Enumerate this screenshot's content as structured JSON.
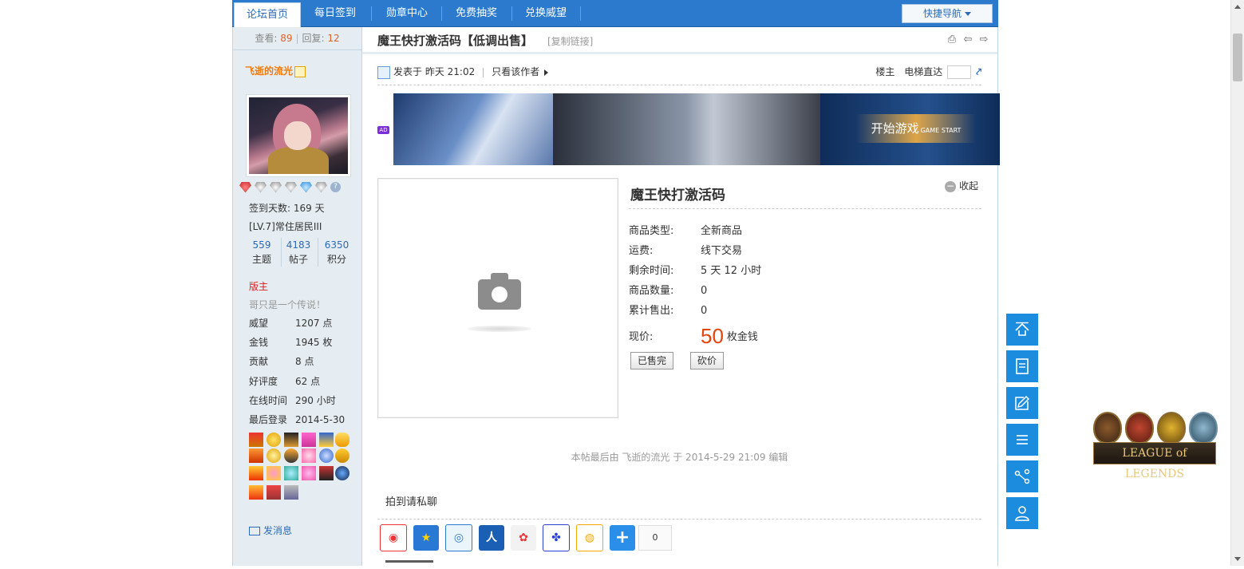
{
  "nav": {
    "tabs": [
      {
        "label": "论坛首页",
        "active": true
      },
      {
        "label": "每日签到",
        "active": false
      },
      {
        "label": "勋章中心",
        "active": false
      },
      {
        "label": "免费抽奖",
        "active": false
      },
      {
        "label": "兑换威望",
        "active": false
      }
    ],
    "quick_nav": "快捷导航"
  },
  "thread_stats": {
    "views_label": "查看:",
    "views": "89",
    "replies_label": "回复:",
    "replies": "12"
  },
  "user": {
    "name": "飞逝的流光",
    "checkin": "签到天数: 169 天",
    "level": "[LV.7]常住居民III",
    "stats": [
      {
        "value": "559",
        "label": "主题"
      },
      {
        "value": "4183",
        "label": "帖子"
      },
      {
        "value": "6350",
        "label": "积分"
      }
    ],
    "role": "版主",
    "motto": "哥只是一个传说！",
    "details": [
      {
        "key": "威望",
        "value": "1207 点"
      },
      {
        "key": "金钱",
        "value": "1945 枚"
      },
      {
        "key": "贡献",
        "value": "8 点"
      },
      {
        "key": "好评度",
        "value": "62 点"
      },
      {
        "key": "在线时间",
        "value": "290 小时"
      },
      {
        "key": "最后登录",
        "value": "2014-5-30"
      }
    ],
    "send_message": "发消息"
  },
  "thread": {
    "title": "魔王快打激活码【低调出售】",
    "copy_link": "[复制链接]",
    "posted": "发表于 昨天 21:02",
    "only_author": "只看该作者",
    "floor_label": "楼主",
    "elevator_label": "电梯直达"
  },
  "banner": {
    "ad_tag": "AD",
    "button": "开始游戏",
    "button_small": "GAME START"
  },
  "product": {
    "name": "魔王快打激活码",
    "collapse": "收起",
    "fields": [
      {
        "key": "商品类型:",
        "value": "全新商品"
      },
      {
        "key": "运费:",
        "value": "线下交易"
      },
      {
        "key": "剩余时间:",
        "value": "5 天 12 小时"
      },
      {
        "key": "商品数量:",
        "value": "0"
      },
      {
        "key": "累计售出:",
        "value": "0"
      }
    ],
    "price_label": "现价:",
    "price": "50",
    "price_unit": "枚金钱",
    "sold_out_button": "已售完",
    "bargain_button": "砍价"
  },
  "post": {
    "edit_note": "本帖最后由 飞逝的流光 于 2014-5-29 21:09 编辑",
    "pm_note": "拍到请私聊",
    "share_count": "0"
  },
  "side_logo": {
    "text": "LEAGUE of LEGENDS"
  },
  "colors": {
    "nav_blue": "#2b7acd",
    "side_button_blue": "#1b8cde",
    "price_red": "#e6440b",
    "username_orange": "#f27a0a",
    "panel_bg": "#e5edf2"
  }
}
